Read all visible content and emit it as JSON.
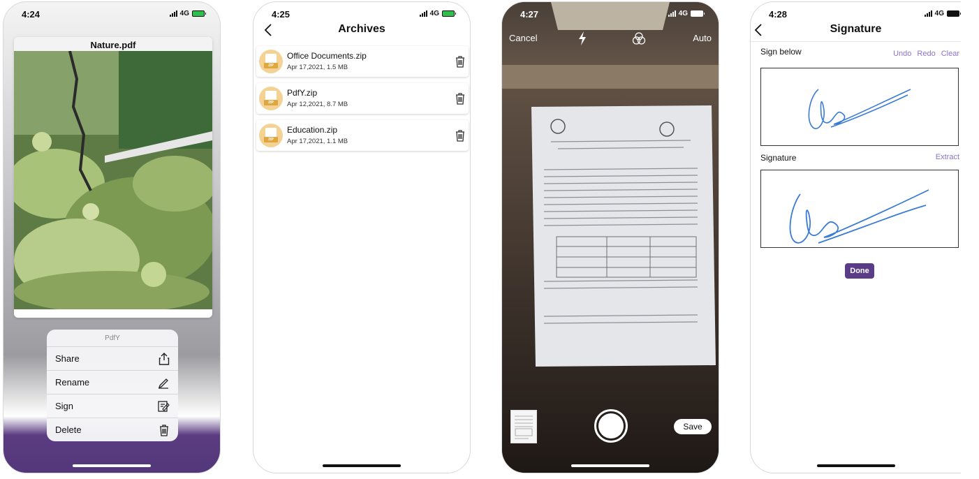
{
  "screens": [
    {
      "status": {
        "time": "4:24",
        "network": "4G"
      },
      "document_title": "Nature.pdf",
      "action_sheet": {
        "title": "PdfY",
        "items": [
          {
            "label": "Share",
            "icon": "share-icon"
          },
          {
            "label": "Rename",
            "icon": "pencil-icon"
          },
          {
            "label": "Sign",
            "icon": "sign-icon"
          },
          {
            "label": "Delete",
            "icon": "trash-icon"
          }
        ]
      }
    },
    {
      "status": {
        "time": "4:25",
        "network": "4G"
      },
      "title": "Archives",
      "files": [
        {
          "name": "Office Documents.zip",
          "meta": "Apr 17,2021, 1.5 MB"
        },
        {
          "name": "PdfY.zip",
          "meta": "Apr 12,2021, 8.7 MB"
        },
        {
          "name": "Education.zip",
          "meta": "Apr 17,2021, 1.1 MB"
        }
      ],
      "zip_tag": "ZIP"
    },
    {
      "status": {
        "time": "4:27",
        "network": "4G"
      },
      "cancel_label": "Cancel",
      "mode_label": "Auto",
      "save_label": "Save"
    },
    {
      "status": {
        "time": "4:28",
        "network": "4G"
      },
      "title": "Signature",
      "sign_below_label": "Sign below",
      "actions": [
        "Undo",
        "Redo",
        "Clear"
      ],
      "signature_label": "Signature",
      "extract_label": "Extract",
      "done_label": "Done"
    }
  ],
  "colors": {
    "accent": "#5b3c88",
    "link": "#8a74c8",
    "zip_badge": "#f3d294",
    "signature_ink": "#3a7bd5"
  }
}
